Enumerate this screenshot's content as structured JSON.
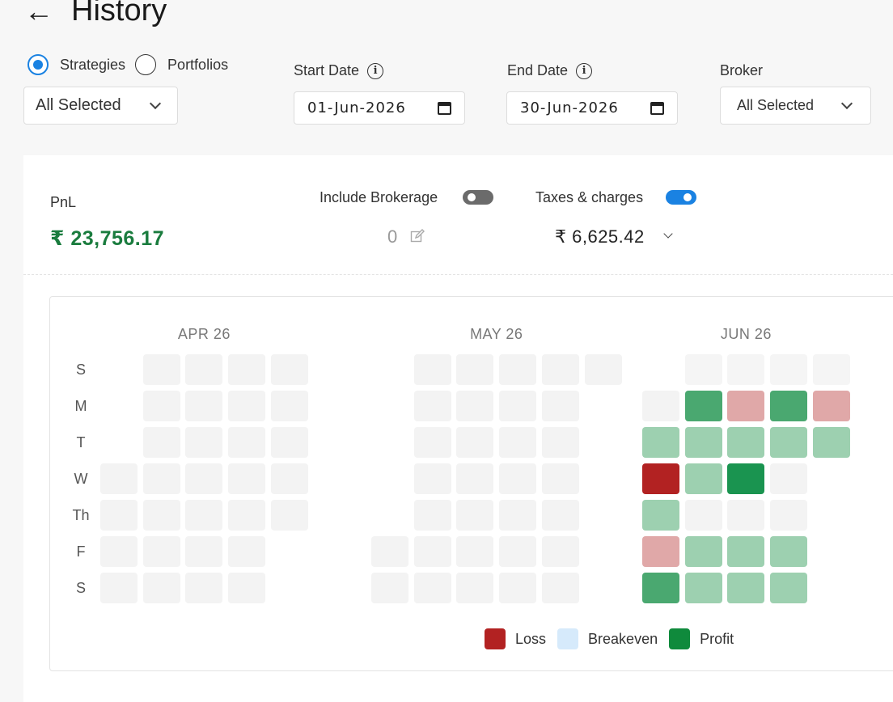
{
  "header": {
    "back_glyph": "←",
    "title": "History"
  },
  "mode": {
    "options": [
      {
        "label": "Strategies",
        "checked": true
      },
      {
        "label": "Portfolios",
        "checked": false
      }
    ],
    "select_value": "All Selected"
  },
  "start_date": {
    "label": "Start Date",
    "value": "01-Jun-2026"
  },
  "end_date": {
    "label": "End Date",
    "value": "30-Jun-2026"
  },
  "broker": {
    "label": "Broker",
    "value": "All Selected"
  },
  "summary": {
    "pnl_label": "PnL",
    "pnl_value": "₹ 23,756.17",
    "brokerage_label": "Include Brokerage",
    "brokerage_enabled": false,
    "brokerage_value": "0",
    "taxes_label": "Taxes & charges",
    "taxes_enabled": true,
    "taxes_value": "₹ 6,625.42"
  },
  "heatmap": {
    "day_labels": [
      "S",
      "M",
      "T",
      "W",
      "Th",
      "F",
      "S"
    ],
    "months": [
      {
        "label": "APR 26",
        "first_weekday": 3,
        "days": 30,
        "levels": {}
      },
      {
        "label": "MAY 26",
        "first_weekday": 5,
        "days": 31,
        "levels": {}
      },
      {
        "label": "JUN 26",
        "first_weekday": 1,
        "days": 30,
        "levels": {
          "1": 0,
          "2": 1,
          "3": -2,
          "4": 1,
          "5": -1,
          "6": 2,
          "7": 0,
          "8": 2,
          "9": 1,
          "10": 1,
          "12": 1,
          "13": 1,
          "14": 0,
          "15": -1,
          "16": 1,
          "17": 2,
          "19": 1,
          "20": 1,
          "21": 0,
          "22": 2,
          "23": 1,
          "24": 0,
          "26": 1,
          "27": 1,
          "28": 0,
          "29": -1,
          "30": 1
        }
      }
    ],
    "colors": {
      "empty": "#f3f3f3",
      "loss_strong": "#b22222",
      "loss_light": "#e0a8a8",
      "profit_light": "#9dd0b0",
      "profit_medium": "#4aa870",
      "profit_strong": "#1a9450"
    },
    "legend": [
      {
        "label": "Loss",
        "color": "#b22222"
      },
      {
        "label": "Breakeven",
        "color": "#d6eafb"
      },
      {
        "label": "Profit",
        "color": "#0f8a3c"
      }
    ]
  }
}
